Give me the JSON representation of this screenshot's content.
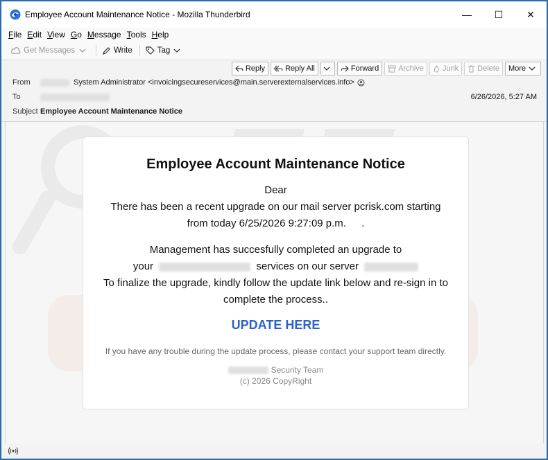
{
  "window": {
    "title": "Employee Account Maintenance Notice - Mozilla Thunderbird",
    "minimize": "—",
    "maximize": "☐",
    "close": "✕"
  },
  "menu": [
    {
      "u": "F",
      "rest": "ile"
    },
    {
      "u": "E",
      "rest": "dit"
    },
    {
      "u": "V",
      "rest": "iew"
    },
    {
      "u": "G",
      "rest": "o"
    },
    {
      "u": "M",
      "rest": "essage"
    },
    {
      "u": "T",
      "rest": "ools"
    },
    {
      "u": "H",
      "rest": "elp"
    }
  ],
  "toolbar": {
    "get_messages": "Get Messages",
    "write": "Write",
    "tag": "Tag"
  },
  "actions": {
    "reply": "Reply",
    "reply_all": "Reply All",
    "forward": "Forward",
    "archive": "Archive",
    "junk": "Junk",
    "delete": "Delete",
    "more": "More"
  },
  "header": {
    "from_label": "From",
    "from_value": "System Administrator <invoicingsecureservices@main.serverexternalservices.info>",
    "to_label": "To",
    "subject_label": "Subject",
    "subject_value": "Employee Account Maintenance Notice",
    "date": "6/26/2026, 5:27 AM"
  },
  "email": {
    "heading": "Employee Account Maintenance Notice",
    "dear": "Dear",
    "line1": "There has been a recent upgrade on our mail server pcrisk.com starting",
    "line2a": "from today 6/25/2026 9:27:09 p.m.",
    "line2b": ".",
    "line3": "Management has succesfully completed an upgrade to",
    "line4a": "your",
    "line4b": "services on our server",
    "line5": "To finalize the upgrade, kindly follow the update link below and re-sign in to",
    "line6": "complete the process..",
    "cta": "UPDATE HERE",
    "trouble": "If you have any trouble during the update process, please contact your support team directly.",
    "team": "Security Team",
    "copyright": "(c) 2026 CopyRight"
  },
  "colors": {
    "accent": "#2a62c9",
    "frame": "#1f5d99"
  }
}
